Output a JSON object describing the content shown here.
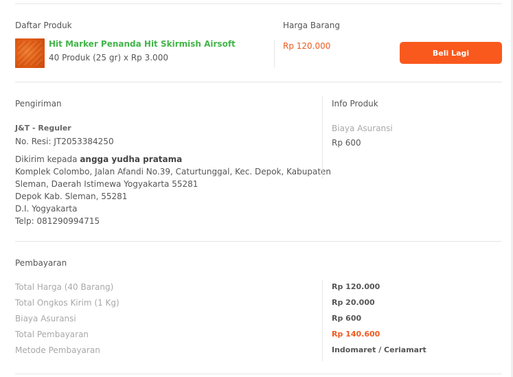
{
  "order": {
    "products_header": "Daftar Produk",
    "price_header": "Harga Barang",
    "product": {
      "image_icon": "product-thumbnail",
      "name": "Hit Marker Penanda Hit Skirmish Airsoft",
      "qty_line": "40 Produk (25 gr) x Rp 3.000",
      "price": "Rp 120.000"
    },
    "buy_again_label": "Beli Lagi"
  },
  "shipping": {
    "header": "Pengiriman",
    "courier": "J&T - Reguler",
    "resi": "No. Resi: JT2053384250",
    "sent_to_prefix": "Dikirim kepada",
    "recipient": "angga yudha pratama",
    "address_line1": "Komplek Colombo, Jalan Afandi No.39, Caturtunggal, Kec. Depok, Kabupaten",
    "address_line2": "Sleman, Daerah Istimewa Yogyakarta 55281",
    "address_line3": "Depok Kab. Sleman, 55281",
    "address_line4": "D.I. Yogyakarta",
    "phone": "Telp: 081290994715"
  },
  "product_info": {
    "header": "Info Produk",
    "insurance_label": "Biaya Asuransi",
    "insurance_value": "Rp 600"
  },
  "payment": {
    "header": "Pembayaran",
    "rows": [
      {
        "label": "Total Harga (40 Barang)",
        "value": "Rp 120.000"
      },
      {
        "label": "Total Ongkos Kirim (1 Kg)",
        "value": "Rp 20.000"
      },
      {
        "label": "Biaya Asuransi",
        "value": "Rp 600"
      },
      {
        "label": "Total Pembayaran",
        "value": "Rp 140.600"
      },
      {
        "label": "Metode Pembayaran",
        "value": "Indomaret / Ceriamart"
      }
    ]
  },
  "colors": {
    "accent_orange": "#fa591d",
    "price_orange": "#f05a1e",
    "product_green": "#42b549"
  }
}
